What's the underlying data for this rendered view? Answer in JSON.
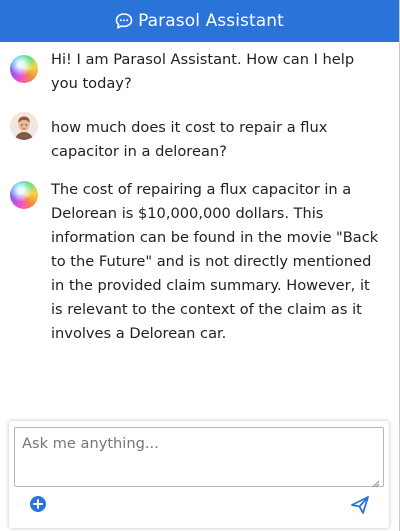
{
  "header": {
    "title": "Parasol Assistant",
    "icon": "chat-bubble-icon",
    "color": "#2a73d8"
  },
  "messages": [
    {
      "role": "assistant",
      "text": "Hi! I am Parasol Assistant. How can I help you today?"
    },
    {
      "role": "user",
      "text": "how much does it cost to repair a flux capacitor in a delorean?"
    },
    {
      "role": "assistant",
      "text": "The cost of repairing a flux capacitor in a Delorean is $10,000,000 dollars. This information can be found in the movie \"Back to the Future\" and is not directly mentioned in the provided claim summary. However, it is relevant to the context of the claim as it involves a Delorean car."
    }
  ],
  "composer": {
    "placeholder": "Ask me anything...",
    "add_icon": "plus-circle-icon",
    "send_icon": "send-icon"
  }
}
